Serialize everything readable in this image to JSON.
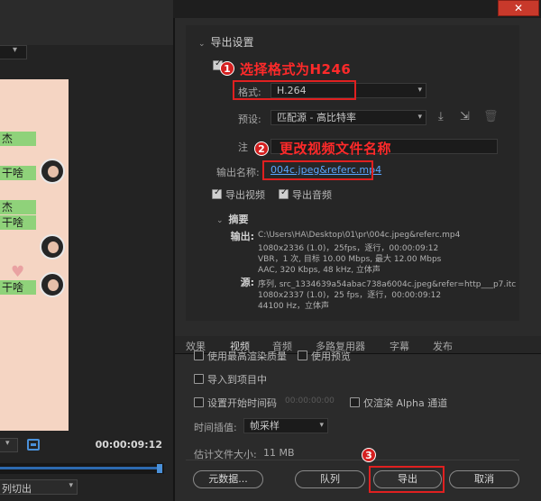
{
  "window": {
    "close_glyph": "✕"
  },
  "left_panel": {
    "preview_chats": [
      "杰",
      "干啥",
      "杰",
      "干啥",
      "干啥"
    ],
    "timecode": "00:00:09:12",
    "transition_select": "列切出",
    "dropdown_caret": "▾"
  },
  "export_settings": {
    "section_title": "导出设置",
    "format_label": "格式:",
    "format_value": "H.264",
    "preset_label": "预设:",
    "preset_value": "匹配源 - 高比特率",
    "comment_label": "注",
    "output_name_label": "输出名称:",
    "output_name_value": "004c.jpeg&referc.mp4",
    "export_video_label": "导出视频",
    "export_audio_label": "导出音频",
    "export_video_checked": true,
    "export_audio_checked": true
  },
  "summary": {
    "title": "摘要",
    "output_key": "输出:",
    "output_lines": [
      "C:\\Users\\HA\\Desktop\\01\\pr\\004c.jpeg&referc.mp4",
      "1080x2336 (1.0)，25fps，逐行，00:00:09:12",
      "VBR，1 次, 目标 10.00 Mbps, 最大 12.00 Mbps",
      "AAC, 320 Kbps, 48  kHz, 立体声"
    ],
    "source_key": "源:",
    "source_lines": [
      "序列, src_1334639a54abac738a6004c.jpeg&refer=http___p7.itc",
      "1080x2337 (1.0)，25 fps，逐行，00:00:09:12",
      "44100 Hz，立体声"
    ]
  },
  "annotations": {
    "step1_number": "1",
    "step1_text": "选择格式为H246",
    "step2_number": "2",
    "step2_text": "更改视频文件名称",
    "step3_number": "3",
    "accent_color": "#e02020"
  },
  "tabs": [
    "效果",
    "视频",
    "音频",
    "多路复用器",
    "字幕",
    "发布"
  ],
  "options": {
    "max_render_quality": "使用最高渲染质量",
    "use_previews": "使用预览",
    "import_into_project": "导入到项目中",
    "set_start_timecode": "设置开始时间码",
    "start_timecode_value": "00:00:00:00",
    "render_alpha_only": "仅渲染 Alpha 通道",
    "time_interpolation_label": "时间插值:",
    "time_interpolation_value": "帧采样",
    "estimated_size_label": "估计文件大小:",
    "estimated_size_value": "11 MB"
  },
  "buttons": {
    "metadata": "元数据...",
    "queue": "队列",
    "export": "导出",
    "cancel": "取消"
  },
  "icons": {
    "save_preset": "download-icon",
    "import_preset": "import-preset-icon",
    "delete_preset": "trash-icon",
    "caret": "▾",
    "chevron": "⌄"
  }
}
